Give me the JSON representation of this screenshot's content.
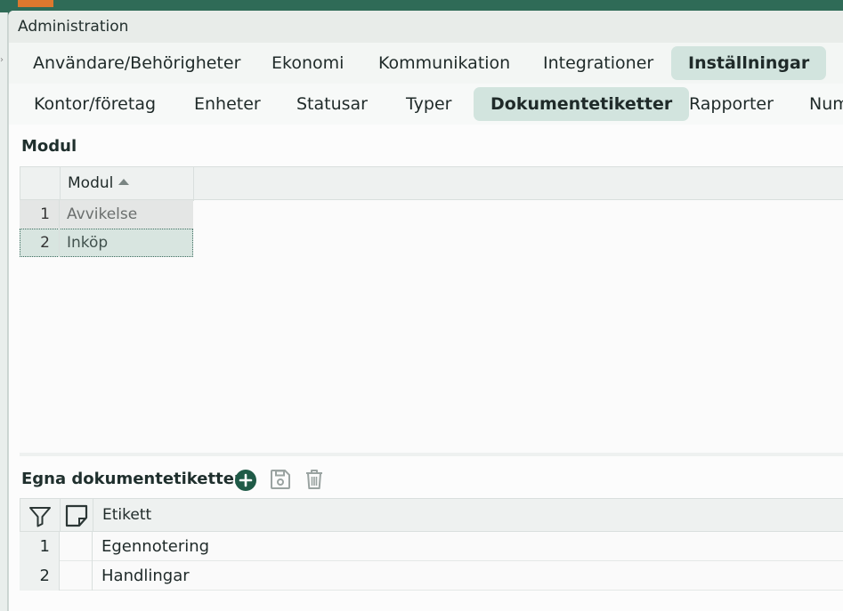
{
  "window": {
    "title": "Administration"
  },
  "main_tabs": [
    {
      "label": "Användare/Behörigheter",
      "active": false
    },
    {
      "label": "Ekonomi",
      "active": false
    },
    {
      "label": "Kommunikation",
      "active": false
    },
    {
      "label": "Integrationer",
      "active": false
    },
    {
      "label": "Inställningar",
      "active": true
    }
  ],
  "sub_tabs": [
    {
      "label": "Kontor/företag",
      "active": false
    },
    {
      "label": "Enheter",
      "active": false
    },
    {
      "label": "Statusar",
      "active": false
    },
    {
      "label": "Typer",
      "active": false
    },
    {
      "label": "Dokumentetiketter",
      "active": true
    },
    {
      "label": "Rapporter",
      "active": false
    },
    {
      "label": "Num",
      "active": false
    }
  ],
  "module_section": {
    "title": "Modul",
    "column_header": "Modul",
    "sort": "ascending",
    "rows": [
      {
        "num": "1",
        "value": "Avvikelse"
      },
      {
        "num": "2",
        "value": "Inköp",
        "selected": true
      }
    ]
  },
  "labels_section": {
    "title": "Egna dokumentetiketter",
    "toolbar": {
      "add_icon": "add-circle-icon",
      "save_icon": "save-icon",
      "delete_icon": "trash-icon"
    },
    "column_header": "Etikett",
    "rows": [
      {
        "num": "1",
        "value": "Egennotering"
      },
      {
        "num": "2",
        "value": "Handlingar"
      }
    ]
  },
  "colors": {
    "accent": "#1f5a47",
    "active_tab": "#d2e4de",
    "selected_row": "#d8e5e0",
    "header_bg": "#eef1f0"
  }
}
